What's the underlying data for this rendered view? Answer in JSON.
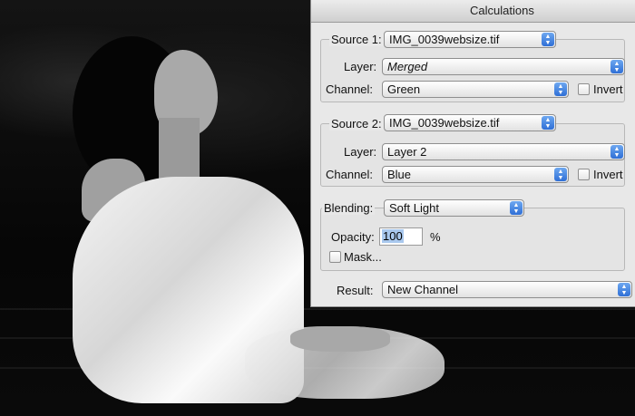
{
  "dialog": {
    "title": "Calculations",
    "source1": {
      "label": "Source 1:",
      "file": "IMG_0039websize.tif",
      "layer_label": "Layer:",
      "layer": "Merged",
      "channel_label": "Channel:",
      "channel": "Green",
      "invert_label": "Invert",
      "invert_checked": false
    },
    "source2": {
      "label": "Source 2:",
      "file": "IMG_0039websize.tif",
      "layer_label": "Layer:",
      "layer": "Layer 2",
      "channel_label": "Channel:",
      "channel": "Blue",
      "invert_label": "Invert",
      "invert_checked": false
    },
    "blending": {
      "label": "Blending:",
      "mode": "Soft Light",
      "opacity_label": "Opacity:",
      "opacity_value": "100",
      "opacity_unit": "%",
      "mask_label": "Mask...",
      "mask_checked": false
    },
    "result": {
      "label": "Result:",
      "value": "New Channel"
    }
  },
  "icons": {
    "popup_arrow": "up-down-arrows-icon"
  }
}
